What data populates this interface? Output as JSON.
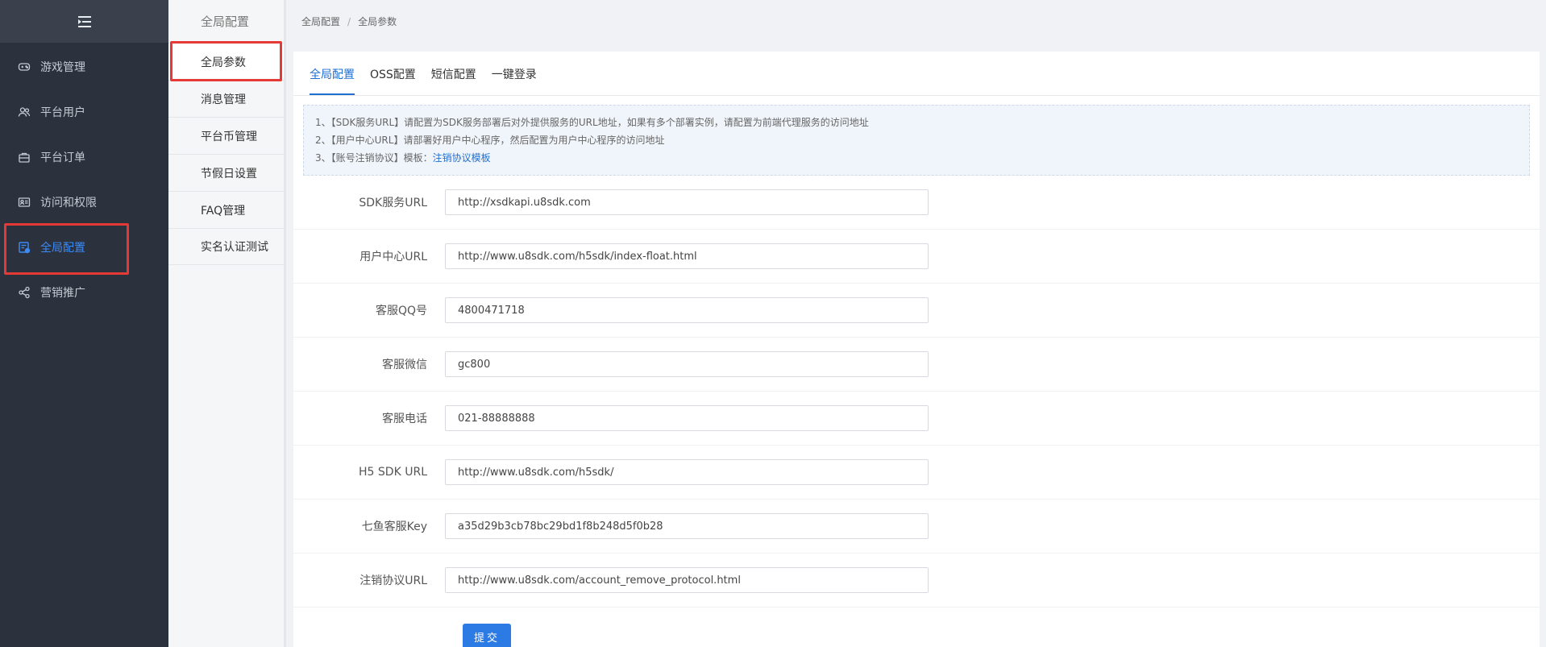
{
  "sidebar": {
    "items": [
      {
        "label": "游戏管理",
        "icon": "gamepad-icon"
      },
      {
        "label": "平台用户",
        "icon": "users-icon"
      },
      {
        "label": "平台订单",
        "icon": "order-icon"
      },
      {
        "label": "访问和权限",
        "icon": "id-card-icon"
      },
      {
        "label": "全局配置",
        "icon": "config-icon"
      },
      {
        "label": "营销推广",
        "icon": "share-icon"
      }
    ]
  },
  "submenu": {
    "title": "全局配置",
    "items": [
      {
        "label": "全局参数"
      },
      {
        "label": "消息管理"
      },
      {
        "label": "平台币管理"
      },
      {
        "label": "节假日设置"
      },
      {
        "label": "FAQ管理"
      },
      {
        "label": "实名认证测试"
      }
    ]
  },
  "breadcrumb": {
    "items": [
      "全局配置",
      "全局参数"
    ],
    "separator": "/"
  },
  "tabs": [
    "全局配置",
    "OSS配置",
    "短信配置",
    "一键登录"
  ],
  "notice": {
    "line1": "1、【SDK服务URL】请配置为SDK服务部署后对外提供服务的URL地址，如果有多个部署实例，请配置为前端代理服务的访问地址",
    "line2": "2、【用户中心URL】请部署好用户中心程序，然后配置为用户中心程序的访问地址",
    "line3_prefix": "3、【账号注销协议】模板：",
    "line3_link": "注销协议模板"
  },
  "form": {
    "fields": [
      {
        "label": "SDK服务URL",
        "value": "http://xsdkapi.u8sdk.com"
      },
      {
        "label": "用户中心URL",
        "value": "http://www.u8sdk.com/h5sdk/index-float.html"
      },
      {
        "label": "客服QQ号",
        "value": "4800471718"
      },
      {
        "label": "客服微信",
        "value": "gc800"
      },
      {
        "label": "客服电话",
        "value": "021-88888888"
      },
      {
        "label": "H5 SDK URL",
        "value": "http://www.u8sdk.com/h5sdk/"
      },
      {
        "label": "七鱼客服Key",
        "value": "a35d29b3cb78bc29bd1f8b248d5f0b28"
      },
      {
        "label": "注销协议URL",
        "value": "http://www.u8sdk.com/account_remove_protocol.html"
      }
    ],
    "submit_label": "提交"
  },
  "colors": {
    "sidebar_bg": "#2b313d",
    "accent": "#1f6fd1",
    "highlight": "#e53935"
  }
}
